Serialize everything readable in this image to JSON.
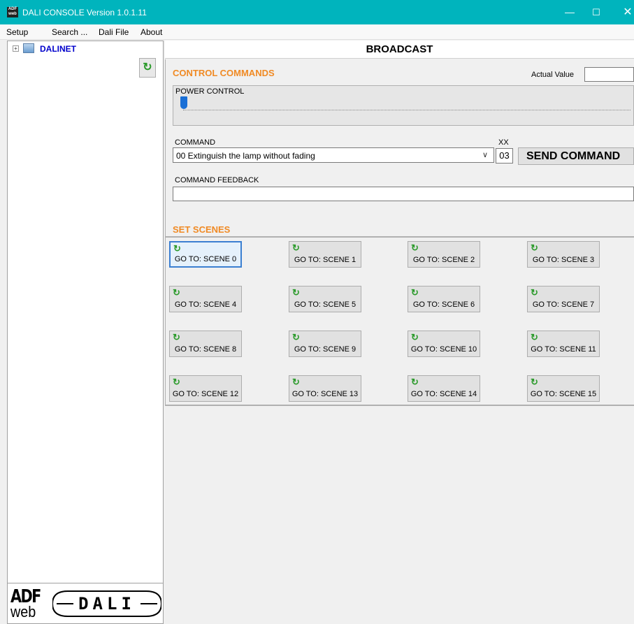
{
  "window": {
    "title": "DALI CONSOLE Version 1.0.1.11",
    "icon_text": "ADF\nweb",
    "minimize": "—",
    "maximize": "☐",
    "close": "✕"
  },
  "menu": {
    "items": [
      "Setup",
      "Search ...",
      "Dali File",
      "About"
    ]
  },
  "tree": {
    "expander": "+",
    "root_label": "DALINET",
    "refresh_icon": "↻"
  },
  "logo": {
    "adf_top": "ADF",
    "adf_bottom": "web",
    "dali_text": "DALI"
  },
  "header": {
    "title": "BROADCAST"
  },
  "control": {
    "section_title": "CONTROL COMMANDS",
    "actual_value_label": "Actual Value",
    "actual_value": "",
    "power_label": "POWER CONTROL",
    "power_level": 0,
    "command_label": "COMMAND",
    "command_value": "00 Extinguish the lamp without fading",
    "dropdown_arrow": "∨",
    "xx_label": "XX",
    "xx_value": "03",
    "send_label": "SEND COMMAND",
    "feedback_label": "COMMAND FEEDBACK",
    "feedback_value": ""
  },
  "scenes": {
    "section_title": "SET SCENES",
    "refresh_icon": "↻",
    "buttons": [
      "GO TO: SCENE 0",
      "GO TO: SCENE 1",
      "GO TO: SCENE 2",
      "GO TO: SCENE 3",
      "GO TO: SCENE 4",
      "GO TO: SCENE 5",
      "GO TO: SCENE 6",
      "GO TO: SCENE 7",
      "GO TO: SCENE 8",
      "GO TO: SCENE 9",
      "GO TO: SCENE 10",
      "GO TO: SCENE 11",
      "GO TO: SCENE 12",
      "GO TO: SCENE 13",
      "GO TO: SCENE 14",
      "GO TO: SCENE 15"
    ]
  },
  "colors": {
    "titlebar": "#00b4bd",
    "section_title": "#f08a24",
    "tree_label": "#0000cc",
    "refresh_green": "#2a9a2a",
    "slider_thumb": "#1a6fd6"
  }
}
